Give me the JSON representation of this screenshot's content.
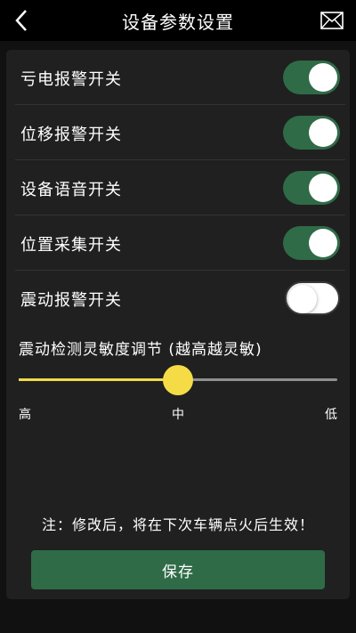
{
  "header": {
    "title": "设备参数设置",
    "back_icon": "chevron-left-icon",
    "mail_icon": "mail-icon"
  },
  "settings": [
    {
      "label": "亏电报警开关",
      "on": true
    },
    {
      "label": "位移报警开关",
      "on": true
    },
    {
      "label": "设备语音开关",
      "on": true
    },
    {
      "label": "位置采集开关",
      "on": true
    },
    {
      "label": "震动报警开关",
      "on": false
    }
  ],
  "sensitivity": {
    "title": "震动检测灵敏度调节 (越高越灵敏)",
    "value_fraction": 0.5,
    "ticks": [
      "高",
      "中",
      "低"
    ]
  },
  "note": "注：修改后，将在下次车辆点火后生效！",
  "save_label": "保存",
  "colors": {
    "accent_green": "#2f6b47",
    "slider_yellow": "#f5dc47",
    "background": "#111111",
    "card": "#202020"
  }
}
